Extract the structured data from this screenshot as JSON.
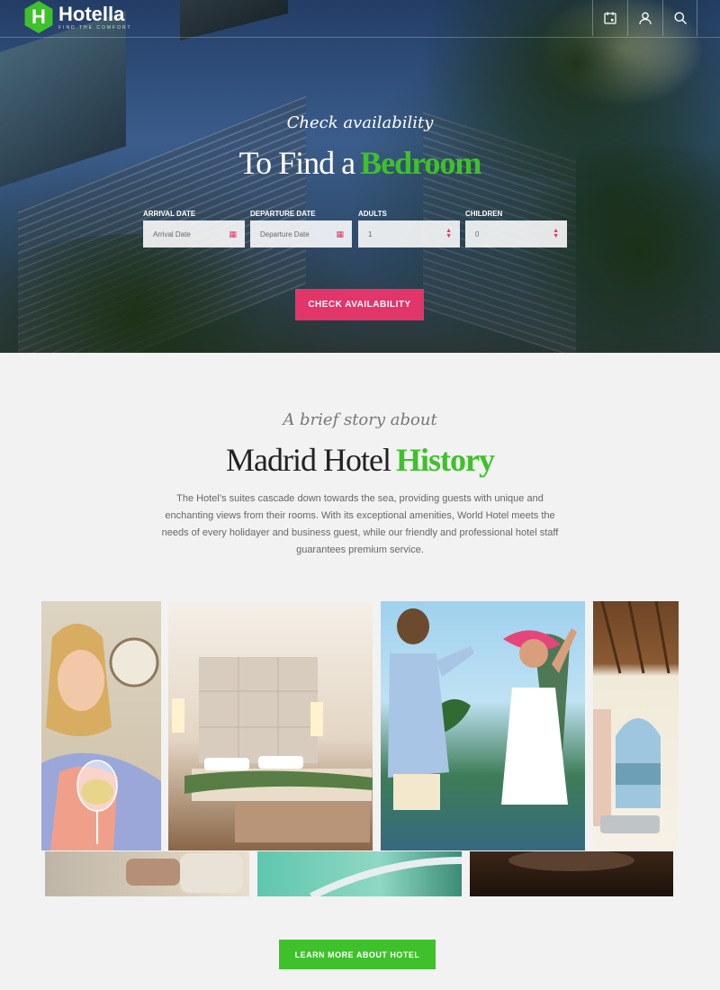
{
  "brand": {
    "name": "Hotella",
    "tagline": "FIND THE COMFORT",
    "mark": "H",
    "accent": "#3ec12b",
    "cta_color": "#e2356a"
  },
  "header": {
    "icons": [
      {
        "name": "calendar-icon"
      },
      {
        "name": "user-icon"
      },
      {
        "name": "search-icon"
      }
    ]
  },
  "hero": {
    "subtitle": "Check availability",
    "title_main": "To Find a",
    "title_accent": "Bedroom",
    "form": {
      "arrival": {
        "label": "ARRIVAL DATE",
        "placeholder": "Arrival Date",
        "icon": "calendar-icon"
      },
      "departure": {
        "label": "DEPARTURE DATE",
        "placeholder": "Departure Date",
        "icon": "calendar-icon"
      },
      "adults": {
        "label": "ADULTS",
        "value": "1",
        "icon": "stepper-icon"
      },
      "children": {
        "label": "CHILDREN",
        "value": "0",
        "icon": "stepper-icon"
      }
    },
    "button": "CHECK AVAILABILITY"
  },
  "history": {
    "subtitle": "A brief story about",
    "title_main": "Madrid Hotel",
    "title_accent": "History",
    "text": "The Hotel’s suites cascade down towards the sea, providing guests with unique and enchanting views from their rooms. With its exceptional amenities, World Hotel meets the needs of every holidayer and business guest, while our friendly and professional hotel staff guarantees premium service.",
    "button": "LEARN MORE ABOUT HOTEL"
  }
}
